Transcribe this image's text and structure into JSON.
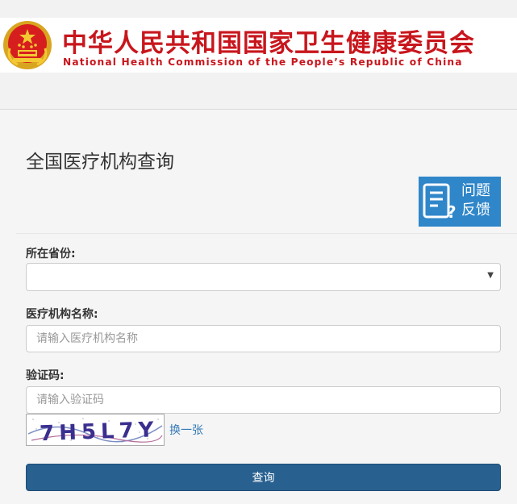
{
  "header": {
    "title_cn": "中华人民共和国国家卫生健康委员会",
    "title_en": "National Health Commission of the People’s Republic of China"
  },
  "main": {
    "page_title": "全国医疗机构查询",
    "feedback": {
      "line1": "问题",
      "line2": "反馈",
      "icon": "feedback-document-icon"
    }
  },
  "form": {
    "province": {
      "label": "所在省份:",
      "value": ""
    },
    "org_name": {
      "label": "医疗机构名称:",
      "placeholder": "请输入医疗机构名称",
      "value": ""
    },
    "captcha": {
      "label": "验证码:",
      "placeholder": "请输入验证码",
      "value": "",
      "image_text": "7H5L7Y",
      "refresh_label": "换一张"
    },
    "submit_label": "查询"
  },
  "colors": {
    "brand_red": "#c8161d",
    "feedback_blue": "#2f86c9",
    "button_blue": "#286090",
    "link_blue": "#337ab7"
  }
}
